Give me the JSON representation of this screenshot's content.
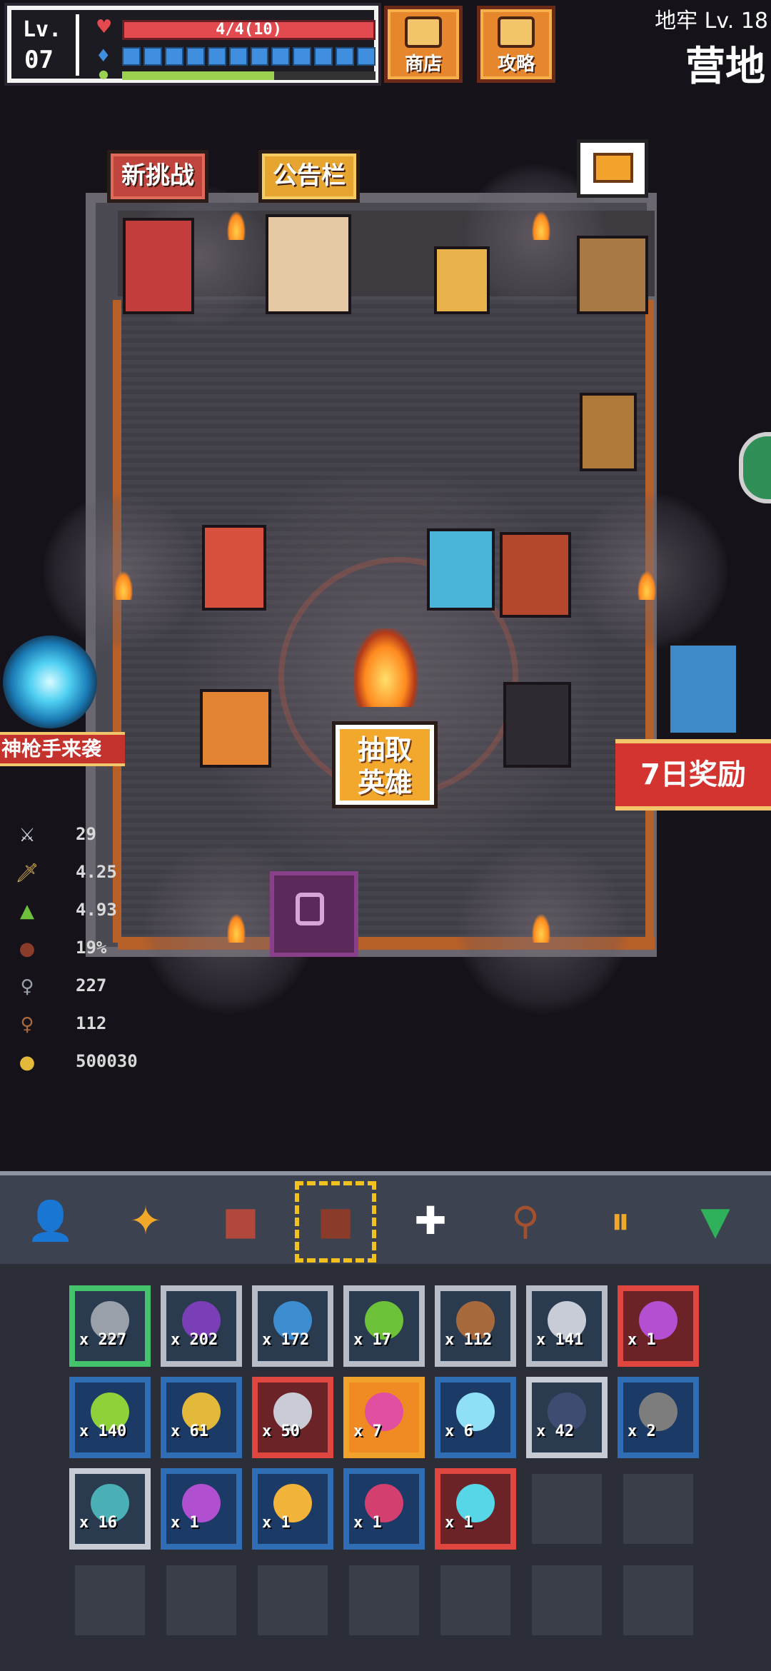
{
  "hud": {
    "level_label": "Lv.",
    "level": "07",
    "hp_text": "4/4(10)",
    "mp_segments": 12,
    "xp_progress": 0.6,
    "shop_label": "商店",
    "guide_label": "攻略"
  },
  "location": {
    "dungeon_level": "地牢 Lv. 18",
    "zone": "营地"
  },
  "camp": {
    "new_challenge": "新挑战",
    "bulletin": "公告栏",
    "draw_hero": "抽取\n英雄",
    "event_banner": "神枪手来袭",
    "seven_day_reward": "7日奖励"
  },
  "stats": [
    {
      "icon": "crossed-swords-icon",
      "value": "29"
    },
    {
      "icon": "sword-icon",
      "value": "4.25"
    },
    {
      "icon": "boot-icon",
      "value": "4.93"
    },
    {
      "icon": "shield-icon",
      "value": "19%"
    },
    {
      "icon": "gray-key-icon",
      "value": "227"
    },
    {
      "icon": "bronze-key-icon",
      "value": "112"
    },
    {
      "icon": "gold-coin-icon",
      "value": "500030"
    }
  ],
  "tabs": [
    {
      "name": "hero-tab",
      "icon": "person-icon",
      "color": "#2f9ee8"
    },
    {
      "name": "skill-tab",
      "icon": "star-icon",
      "color": "#f1a829"
    },
    {
      "name": "book-tab",
      "icon": "book-icon",
      "color": "#b0483c"
    },
    {
      "name": "inventory-tab",
      "icon": "bag-icon",
      "color": "#8a3b2a",
      "selected": true
    },
    {
      "name": "heal-tab",
      "icon": "cross-icon",
      "color": "#ffffff"
    },
    {
      "name": "search-tab",
      "icon": "magnifier-icon",
      "color": "#a1512e"
    },
    {
      "name": "pause-tab",
      "icon": "pause-icon",
      "color": "#f1a829"
    },
    {
      "name": "collapse-tab",
      "icon": "triangle-down-icon",
      "color": "#2fb05a"
    }
  ],
  "inventory": [
    {
      "name": "gray-key",
      "count": "x 227",
      "rarity": "green",
      "color": "#9aa0aa"
    },
    {
      "name": "purple-crystal",
      "count": "x 202",
      "rarity": "gray",
      "color": "#7a3fb6"
    },
    {
      "name": "blue-crystal",
      "count": "x 172",
      "rarity": "gray",
      "color": "#3c8ed0"
    },
    {
      "name": "green-mushroom",
      "count": "x 17",
      "rarity": "gray",
      "color": "#6ec23a"
    },
    {
      "name": "bronze-key",
      "count": "x 112",
      "rarity": "gray",
      "color": "#a8693c"
    },
    {
      "name": "silver-crystal",
      "count": "x 141",
      "rarity": "gray",
      "color": "#c7ccd6"
    },
    {
      "name": "purple-mushroom",
      "count": "x 1",
      "rarity": "red",
      "color": "#b34fd0"
    },
    {
      "name": "green-gem",
      "count": "x 140",
      "rarity": "blue",
      "color": "#8ed13a"
    },
    {
      "name": "gold-key",
      "count": "x 61",
      "rarity": "blue",
      "color": "#e2b93a"
    },
    {
      "name": "hero-scroll",
      "count": "x 50",
      "rarity": "red",
      "color": "#c9ccd4"
    },
    {
      "name": "pink-rune",
      "count": "x 7",
      "rarity": "orange",
      "color": "#e04fa0"
    },
    {
      "name": "ice-crystal",
      "count": "x 6",
      "rarity": "blue",
      "color": "#8fe0f6"
    },
    {
      "name": "dark-crystal",
      "count": "x 42",
      "rarity": "white",
      "color": "#3e4c72"
    },
    {
      "name": "stone-orb",
      "count": "x 2",
      "rarity": "blue",
      "color": "#7d7d7d"
    },
    {
      "name": "teal-orb",
      "count": "x 16",
      "rarity": "white",
      "color": "#4ab0b5"
    },
    {
      "name": "magic-wand",
      "count": "x 1",
      "rarity": "blue",
      "color": "#b04fd0"
    },
    {
      "name": "gold-star",
      "count": "x 1",
      "rarity": "blue",
      "color": "#f2b43a"
    },
    {
      "name": "crimson-crystal",
      "count": "x 1",
      "rarity": "blue",
      "color": "#d33f6f"
    },
    {
      "name": "ice-orb",
      "count": "x 1",
      "rarity": "red",
      "color": "#56d6e6"
    }
  ]
}
